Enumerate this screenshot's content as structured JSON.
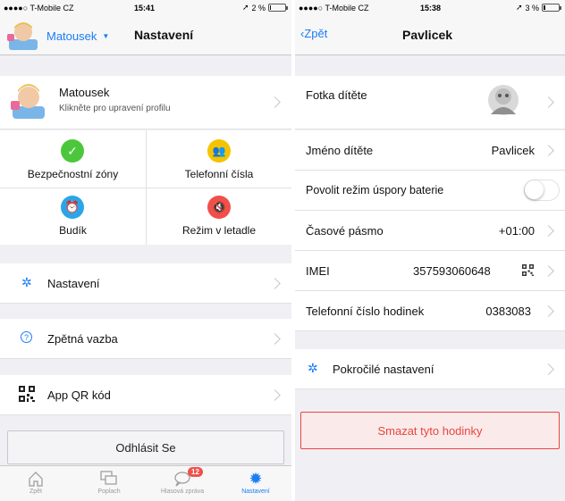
{
  "left": {
    "status": {
      "carrier": "●●●●○ T-Mobile CZ",
      "time": "15:41",
      "battery": "2 %",
      "battery_level": 0.02
    },
    "nav": {
      "profile_name": "Matousek",
      "title": "Nastavení"
    },
    "profile": {
      "name": "Matousek",
      "subtitle": "Klikněte pro upravení profilu"
    },
    "tiles": [
      {
        "label": "Bezpečnostní zóny",
        "icon": "shield-check-icon",
        "color": "#4cc73c"
      },
      {
        "label": "Telefonní čísla",
        "icon": "contacts-icon",
        "color": "#f5c400"
      },
      {
        "label": "Budík",
        "icon": "alarm-clock-icon",
        "color": "#2aa6e8"
      },
      {
        "label": "Režim v letadle",
        "icon": "airplane-mode-icon",
        "color": "#f0504a"
      }
    ],
    "menu": [
      {
        "label": "Nastavení",
        "icon": "gear-icon"
      },
      {
        "label": "Zpětná vazba",
        "icon": "question-icon"
      },
      {
        "label": "App QR kód",
        "icon": "qr-code-icon"
      }
    ],
    "logout": "Odhlásit Se",
    "tabs": [
      {
        "label": "Zpět",
        "icon": "home-icon"
      },
      {
        "label": "Poplach",
        "icon": "alarm-chat-icon"
      },
      {
        "label": "Hlasová zpráva",
        "icon": "speech-bubble-icon",
        "badge": "12"
      },
      {
        "label": "Nastavení",
        "icon": "gear-icon"
      }
    ]
  },
  "right": {
    "status": {
      "carrier": "●●●●○ T-Mobile CZ",
      "time": "15:38",
      "battery": "3 %",
      "battery_level": 0.03
    },
    "nav": {
      "back": "Zpět",
      "title": "Pavlicek"
    },
    "rows": {
      "photo_label": "Fotka dítěte",
      "name_label": "Jméno dítěte",
      "name_value": "Pavlicek",
      "battery_saver_label": "Povolit režim úspory baterie",
      "battery_saver_on": false,
      "timezone_label": "Časové pásmo",
      "timezone_value": "+01:00",
      "imei_label": "IMEI",
      "imei_value": "357593060648",
      "phone_label": "Telefonní číslo hodinek",
      "phone_value": "0383083",
      "advanced_label": "Pokročilé nastavení"
    },
    "delete_label": "Smazat tyto hodinky"
  },
  "colors": {
    "accent": "#1a7cf6",
    "danger": "#e8463f",
    "badge": "#f0504a"
  }
}
